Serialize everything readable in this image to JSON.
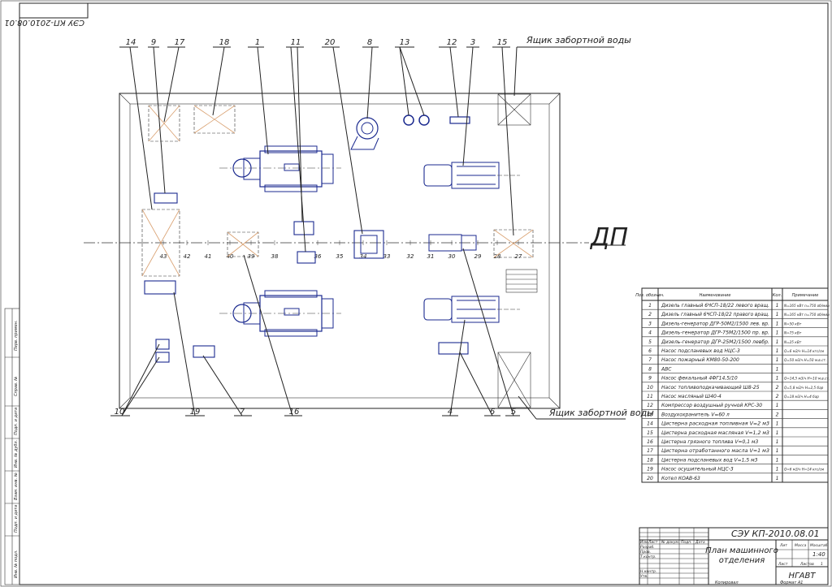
{
  "drawing_code": "СЭУ КП-2010.08.01",
  "drawing_code_rotated": "СЭУ КП-2010.08.01",
  "dp_label": "ДП",
  "box_label_top": "Ящик забортной воды",
  "box_label_bottom": "Ящик забортной воды",
  "top_callouts": [
    "14",
    "9",
    "17",
    "18",
    "1",
    "11",
    "20",
    "8",
    "13",
    "12",
    "3",
    "15"
  ],
  "bottom_callouts": [
    "10",
    "19",
    "7",
    "16",
    "4",
    "6",
    "5"
  ],
  "frames": [
    "43",
    "42",
    "41",
    "40",
    "39",
    "38",
    "36",
    "35",
    "34",
    "33",
    "32",
    "31",
    "30",
    "29",
    "28",
    "27"
  ],
  "spec": {
    "headers": [
      "Поз. обознач.",
      "Наименование",
      "Кол.",
      "Примечание"
    ],
    "rows": [
      [
        "1",
        "Дизель главный 6ЧСП-18/22 левого вращ.",
        "1",
        "N=165 кВт n=750 об/мин"
      ],
      [
        "2",
        "Дизель главный 6ЧСП-18/22 правого вращ.",
        "1",
        "N=165 кВт n=750 об/мин"
      ],
      [
        "3",
        "Дизель-генератор ДГР-50М2/1500 лев. вр.",
        "1",
        "N=50 кВт"
      ],
      [
        "4",
        "Дизель-генератор ДГР-75М2/1500 пр. вр.",
        "1",
        "N=75 кВт"
      ],
      [
        "5",
        "Дизель-генератор ДГР-25М2/1500 левбр.",
        "1",
        "N=25 кВт"
      ],
      [
        "6",
        "Насос подсланевых вод НЦС-3",
        "1",
        "Q=6 м3/ч H=14 кгс/см"
      ],
      [
        "7",
        "Насос пожарный КМ80-50-200",
        "1",
        "Q=50 м3/ч H=50 м.в.ст."
      ],
      [
        "8",
        "АВС",
        "1",
        ""
      ],
      [
        "9",
        "Насос фекальный 4ФГ14,5/10",
        "1",
        "Q=14,5 м3/ч H=10 м.в.ст."
      ],
      [
        "10",
        "Насос топливоподкачивающий Ш8-25",
        "2",
        "Q=5,8 м3/ч H=2,5 бар"
      ],
      [
        "11",
        "Насос масляный Ш40-4",
        "2",
        "Q=18 м3/ч H=4 бар"
      ],
      [
        "12",
        "Компрессор воздушный ручной КРС-30",
        "1",
        ""
      ],
      [
        "13",
        "Воздухохранитель V=60 л",
        "2",
        ""
      ],
      [
        "14",
        "Цистерна расходная топливная V=2 м3",
        "1",
        ""
      ],
      [
        "15",
        "Цистерна расходная масляная V=1,2 м3",
        "1",
        ""
      ],
      [
        "16",
        "Цистерна грязного топлива V=0,1 м3",
        "1",
        ""
      ],
      [
        "17",
        "Цистерна отработанного масла V=1 м3",
        "1",
        ""
      ],
      [
        "18",
        "Цистерна подсланевых вод V=1,5 м3",
        "1",
        ""
      ],
      [
        "19",
        "Насос осушительный НЦС-3",
        "1",
        "Q=6 м3/ч H=14 кгс/см"
      ],
      [
        "20",
        "Котел КОАВ-63",
        "1",
        ""
      ]
    ]
  },
  "title_block": {
    "code": "СЭУ КП-2010.08.01",
    "title_line1": "План машинного",
    "title_line2": "отделения",
    "org": "НГАВТ",
    "scale": "1:40",
    "col_lit": "Лит",
    "col_mass": "Масса",
    "col_scale": "Масштаб",
    "col_sheet": "Лист",
    "col_sheets": "Листов",
    "sheets_count": "1",
    "rows_left": [
      "Изм",
      "Лист",
      "№ докум.",
      "Подп.",
      "Дата"
    ],
    "roles": [
      "Разраб.",
      "Пров.",
      "Т.контр.",
      "",
      "Н.контр.",
      "Утв."
    ],
    "copied": "Копировал",
    "format": "Формат   A1"
  },
  "side_stamp": [
    "Перв. примен.",
    "Справ. №",
    "Подп. и дата",
    "Инв. № дубл.",
    "Взам. инв. №",
    "Подп. и дата",
    "Инв. № подл."
  ]
}
